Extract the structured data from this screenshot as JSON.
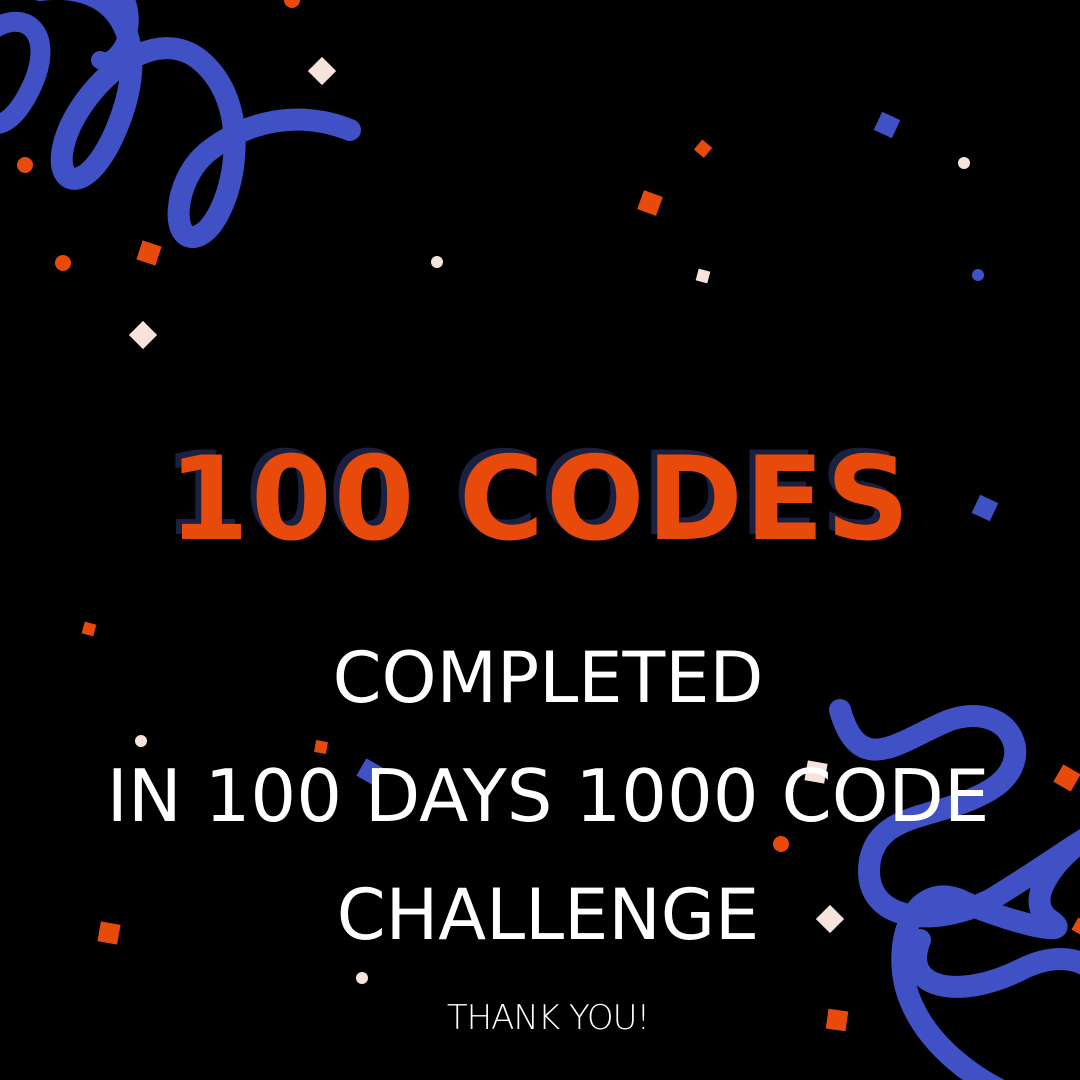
{
  "headline": "100 CODES",
  "lines": [
    "COMPLETED",
    "IN 100 DAYS 1000 CODE",
    "CHALLENGE"
  ],
  "footer": "THANK YOU!",
  "colors": {
    "background": "#000000",
    "accent_orange": "#e84a0c",
    "ribbon_blue": "#3f51c4",
    "text_white": "#ffffff",
    "confetti_cream": "#f6e4dc"
  },
  "icons": [
    "ribbon-streamer-top-left",
    "ribbon-streamer-bottom-right",
    "confetti"
  ]
}
